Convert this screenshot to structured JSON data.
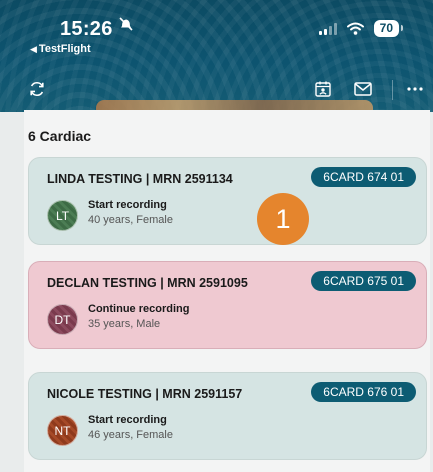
{
  "status_bar": {
    "time": "15:26",
    "back_app": "TestFlight",
    "battery": "70",
    "icons": [
      "silent-mode-icon",
      "signal-icon",
      "wifi-icon",
      "battery-icon"
    ]
  },
  "toolbar": {
    "icons": [
      "refresh-icon",
      "calendar-person-icon",
      "mail-icon",
      "more-icon"
    ]
  },
  "section": {
    "title": "6 Cardiac"
  },
  "patients": [
    {
      "name": "LINDA TESTING | MRN 2591134",
      "badge": "6CARD 674 01",
      "initials": "LT",
      "action": "Start recording",
      "details": "40 years, Female",
      "card_color": "#d5e4e3"
    },
    {
      "name": "DECLAN TESTING | MRN 2591095",
      "badge": "6CARD 675 01",
      "initials": "DT",
      "action": "Continue recording",
      "details": "35 years, Male",
      "card_color": "#efc9d1"
    },
    {
      "name": "NICOLE TESTING | MRN 2591157",
      "badge": "6CARD 676 01",
      "initials": "NT",
      "action": "Start recording",
      "details": "46 years, Female",
      "card_color": "#d5e4e3"
    }
  ],
  "annotation": {
    "marker": "1"
  },
  "colors": {
    "header": "#0c4b63",
    "badge": "#0d5c73",
    "marker": "#e5852d"
  }
}
